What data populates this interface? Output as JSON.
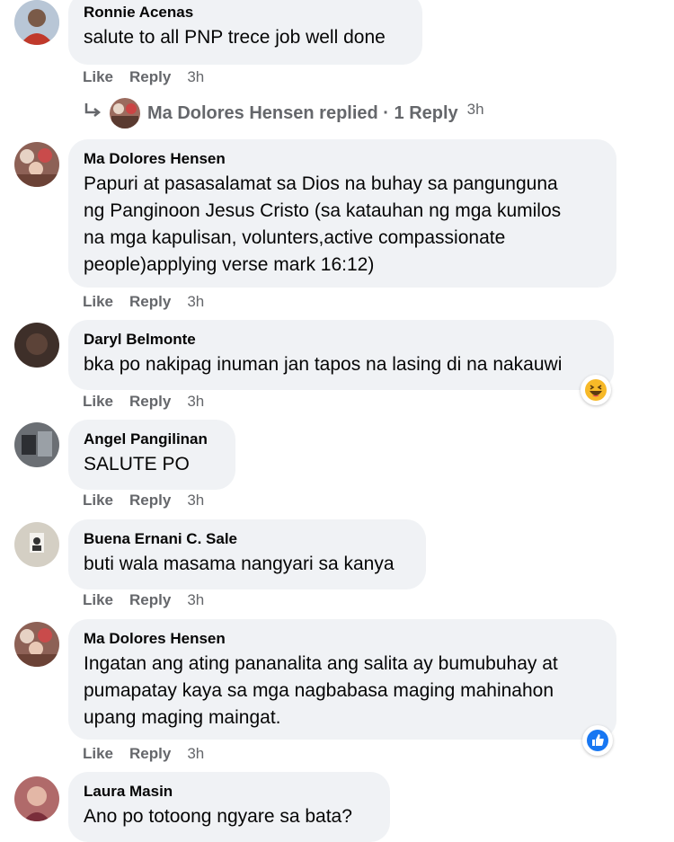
{
  "actions": {
    "like": "Like",
    "reply": "Reply"
  },
  "comments": [
    {
      "author": "Ronnie Acenas",
      "lines": [
        "salute to all PNP trece job well done"
      ],
      "time": "3h"
    },
    {
      "author": "Ma Dolores Hensen",
      "lines": [
        "Papuri at pasasalamat sa Dios na buhay sa pangunguna",
        "ng Panginoon Jesus Cristo (sa katauhan ng mga kumilos",
        "na mga kapulisan, volunters,active compassionate",
        "people)applying verse mark 16:12)"
      ],
      "time": "3h"
    },
    {
      "author": "Daryl Belmonte",
      "lines": [
        "bka po nakipag inuman jan tapos na lasing di na nakauwi"
      ],
      "time": "3h",
      "reaction": "haha-reaction-icon"
    },
    {
      "author": "Angel Pangilinan",
      "lines": [
        "SALUTE PO"
      ],
      "time": "3h"
    },
    {
      "author": "Buena Ernani C. Sale",
      "lines": [
        "buti wala masama nangyari sa kanya"
      ],
      "time": "3h"
    },
    {
      "author": "Ma Dolores Hensen",
      "lines": [
        "Ingatan ang ating pananalita ang salita ay bumubuhay at",
        "pumapatay kaya sa mga nagbabasa maging mahinahon",
        "upang maging maingat."
      ],
      "time": "3h",
      "reaction": "like-reaction-icon"
    },
    {
      "author": "Laura Masin",
      "lines": [
        "Ano po totoong ngyare sa bata?"
      ]
    }
  ],
  "reply_summary": {
    "text": "Ma Dolores Hensen replied · 1 Reply",
    "time": "3h"
  },
  "colors": {
    "bubble": "#f0f2f5",
    "meta": "#65676b",
    "like_blue": "#1877f2",
    "haha_yellow": "#f7b928"
  }
}
